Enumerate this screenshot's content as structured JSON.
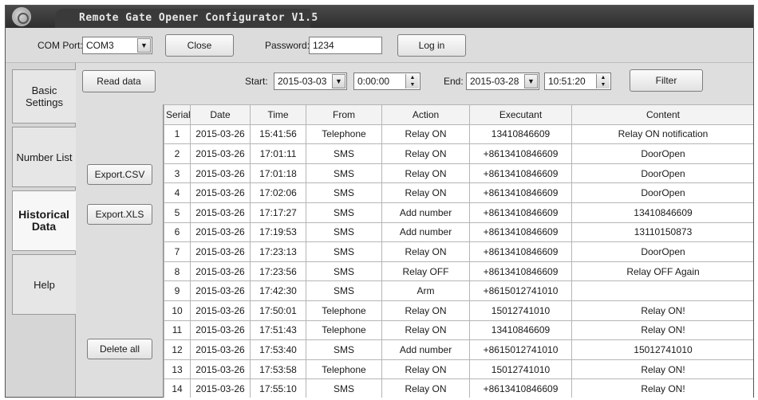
{
  "app": {
    "title": "Remote Gate Opener Configurator V1.5"
  },
  "topbar": {
    "com_port_label": "COM Port:",
    "com_port_value": "COM3",
    "close_label": "Close",
    "password_label": "Password:",
    "password_value": "1234",
    "login_label": "Log in"
  },
  "sidebar": {
    "items": [
      {
        "label": "Basic Settings",
        "active": false
      },
      {
        "label": "Number List",
        "active": false
      },
      {
        "label": "Historical Data",
        "active": true
      },
      {
        "label": "Help",
        "active": false
      }
    ]
  },
  "filter": {
    "read_data_label": "Read data",
    "start_label": "Start:",
    "start_date": "2015-03-03",
    "start_time": "0:00:00",
    "end_label": "End:",
    "end_date": "2015-03-28",
    "end_time": "10:51:20",
    "filter_label": "Filter"
  },
  "actions": {
    "export_csv_label": "Export.CSV",
    "export_xls_label": "Export.XLS",
    "delete_all_label": "Delete all"
  },
  "table": {
    "headers": [
      "Serial",
      "Date",
      "Time",
      "From",
      "Action",
      "Executant",
      "Content"
    ],
    "rows": [
      [
        "1",
        "2015-03-26",
        "15:41:56",
        "Telephone",
        "Relay ON",
        "13410846609",
        "Relay ON notification"
      ],
      [
        "2",
        "2015-03-26",
        "17:01:11",
        "SMS",
        "Relay ON",
        "+8613410846609",
        "DoorOpen"
      ],
      [
        "3",
        "2015-03-26",
        "17:01:18",
        "SMS",
        "Relay ON",
        "+8613410846609",
        "DoorOpen"
      ],
      [
        "4",
        "2015-03-26",
        "17:02:06",
        "SMS",
        "Relay ON",
        "+8613410846609",
        "DoorOpen"
      ],
      [
        "5",
        "2015-03-26",
        "17:17:27",
        "SMS",
        "Add number",
        "+8613410846609",
        "13410846609"
      ],
      [
        "6",
        "2015-03-26",
        "17:19:53",
        "SMS",
        "Add number",
        "+8613410846609",
        "13110150873"
      ],
      [
        "7",
        "2015-03-26",
        "17:23:13",
        "SMS",
        "Relay ON",
        "+8613410846609",
        "DoorOpen"
      ],
      [
        "8",
        "2015-03-26",
        "17:23:56",
        "SMS",
        "Relay OFF",
        "+8613410846609",
        "Relay OFF Again"
      ],
      [
        "9",
        "2015-03-26",
        "17:42:30",
        "SMS",
        "Arm",
        "+8615012741010",
        ""
      ],
      [
        "10",
        "2015-03-26",
        "17:50:01",
        "Telephone",
        "Relay ON",
        "15012741010",
        "Relay ON!"
      ],
      [
        "11",
        "2015-03-26",
        "17:51:43",
        "Telephone",
        "Relay ON",
        "13410846609",
        "Relay ON!"
      ],
      [
        "12",
        "2015-03-26",
        "17:53:40",
        "SMS",
        "Add number",
        "+8615012741010",
        "15012741010"
      ],
      [
        "13",
        "2015-03-26",
        "17:53:58",
        "Telephone",
        "Relay ON",
        "15012741010",
        "Relay ON!"
      ],
      [
        "14",
        "2015-03-26",
        "17:55:10",
        "SMS",
        "Relay ON",
        "+8613410846609",
        "Relay ON!"
      ]
    ]
  }
}
